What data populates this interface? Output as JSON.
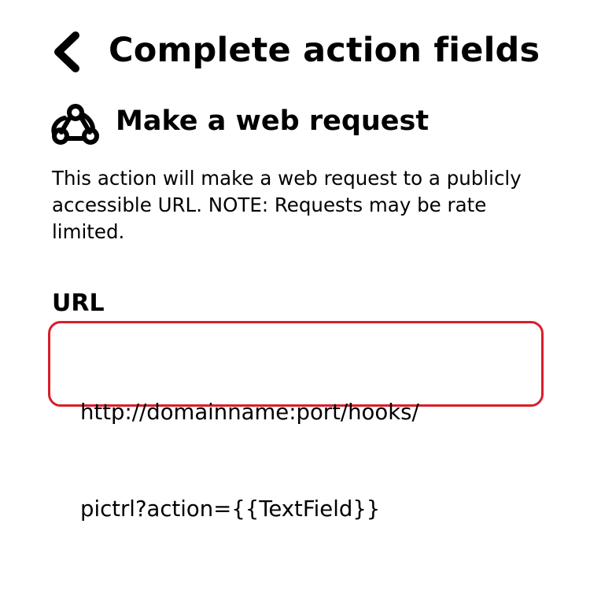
{
  "header": {
    "back_icon": "chevron-left-icon",
    "title": "Complete action fields"
  },
  "action": {
    "icon": "webhook-icon",
    "name": "Make a web request",
    "description": "This action will make a web request to a publicly accessible URL. NOTE: Requests may be rate limited."
  },
  "url_field": {
    "label": "URL",
    "value_line1": "http://domainname:port/hooks/",
    "value_line2": "pictrl?action={{TextField}}",
    "highlight_color": "#d91e2b"
  }
}
